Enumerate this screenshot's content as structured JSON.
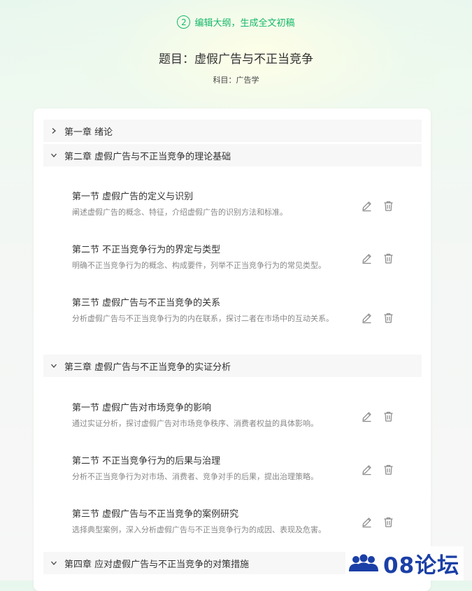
{
  "header": {
    "step_number": "2",
    "step_label": "编辑大纲，生成全文初稿",
    "title": "题目：虚假广告与不正当竞争",
    "subject": "科目：广告学"
  },
  "outline": {
    "chapters": [
      {
        "label": "第一章 绪论",
        "expanded": false,
        "sections": []
      },
      {
        "label": "第二章 虚假广告与不正当竞争的理论基础",
        "expanded": true,
        "sections": [
          {
            "title": "第一节 虚假广告的定义与识别",
            "desc": "阐述虚假广告的概念、特征，介绍虚假广告的识别方法和标准。"
          },
          {
            "title": "第二节 不正当竞争行为的界定与类型",
            "desc": "明确不正当竞争行为的概念、构成要件，列举不正当竞争行为的常见类型。"
          },
          {
            "title": "第三节 虚假广告与不正当竞争的关系",
            "desc": "分析虚假广告与不正当竞争行为的内在联系，探讨二者在市场中的互动关系。"
          }
        ]
      },
      {
        "label": "第三章 虚假广告与不正当竞争的实证分析",
        "expanded": true,
        "sections": [
          {
            "title": "第一节 虚假广告对市场竞争的影响",
            "desc": "通过实证分析，探讨虚假广告对市场竞争秩序、消费者权益的具体影响。"
          },
          {
            "title": "第二节 不正当竞争行为的后果与治理",
            "desc": "分析不正当竞争行为对市场、消费者、竞争对手的后果，提出治理策略。"
          },
          {
            "title": "第三节 虚假广告与不正当竞争的案例研究",
            "desc": "选择典型案例，深入分析虚假广告与不正当竞争行为的成因、表现及危害。"
          }
        ]
      },
      {
        "label": "第四章 应对虚假广告与不正当竞争的对策措施",
        "expanded": true,
        "sections": []
      }
    ]
  },
  "icons": {
    "collapsed": "chevron-right-icon",
    "expanded": "chevron-down-icon",
    "edit": "pencil-icon",
    "delete": "trash-icon"
  },
  "watermark": {
    "text": "08论坛"
  },
  "colors": {
    "accent": "#16b86a",
    "logo": "#1a3fa6"
  }
}
